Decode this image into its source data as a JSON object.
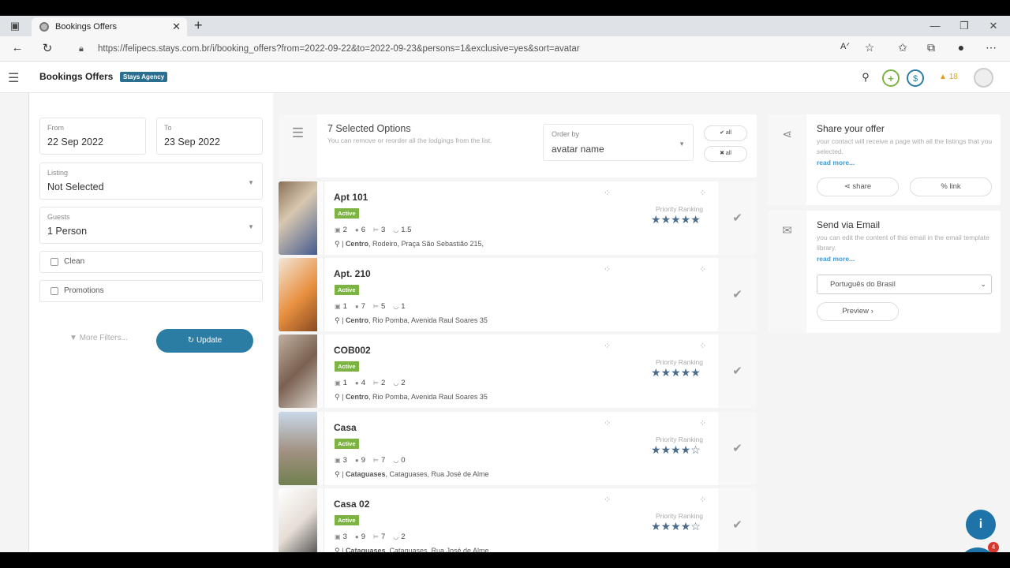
{
  "browser": {
    "tab_title": "Bookings Offers",
    "url": "https://felipecs.stays.com.br/i/booking_offers?from=2022-09-22&to=2022-09-23&persons=1&exclusive=yes&sort=avatar"
  },
  "header": {
    "title": "Bookings Offers",
    "badge": "Stays Agency",
    "alerts_count": "18"
  },
  "filters": {
    "from_label": "From",
    "from_value": "22 Sep 2022",
    "to_label": "To",
    "to_value": "23 Sep 2022",
    "listing_label": "Listing",
    "listing_value": "Not Selected",
    "guests_label": "Guests",
    "guests_value": "1 Person",
    "clean_label": "Clean",
    "promotions_label": "Promotions",
    "more_filters": "More Filters...",
    "update": "Update"
  },
  "selection": {
    "title": "7 Selected Options",
    "subtitle": "You can remove or reorder all the lodgings from the list.",
    "order_label": "Order by",
    "order_value": "avatar name",
    "check_all": "all",
    "uncheck_all": "all"
  },
  "listings": [
    {
      "name": "Apt 101",
      "status": "Active",
      "s1": "2",
      "s2": "6",
      "s3": "3",
      "s4": "1.5",
      "region": "Centro",
      "address": ", Rodeiro, Praça São Sebastião 215,",
      "priority_label": "Priority Ranking",
      "rating": 5
    },
    {
      "name": "Apt. 210",
      "status": "Active",
      "s1": "1",
      "s2": "7",
      "s3": "5",
      "s4": "1",
      "region": "Centro",
      "address": ", Rio Pomba, Avenida Raul Soares 35",
      "priority_label": "",
      "rating": 0
    },
    {
      "name": "COB002",
      "status": "Active",
      "s1": "1",
      "s2": "4",
      "s3": "2",
      "s4": "2",
      "region": "Centro",
      "address": ", Rio Pomba, Avenida Raul Soares 35",
      "priority_label": "Priority Ranking",
      "rating": 5
    },
    {
      "name": "Casa",
      "status": "Active",
      "s1": "3",
      "s2": "9",
      "s3": "7",
      "s4": "0",
      "region": "Cataguases",
      "address": ", Cataguases, Rua José de Alme",
      "priority_label": "Priority Ranking",
      "rating": 4
    },
    {
      "name": "Casa 02",
      "status": "Active",
      "s1": "3",
      "s2": "9",
      "s3": "7",
      "s4": "2",
      "region": "Cataguases",
      "address": ", Cataguases, Rua José de Alme",
      "priority_label": "Priority Ranking",
      "rating": 4
    }
  ],
  "share": {
    "title": "Share your offer",
    "subtitle": "your contact will receive a page with all the listings that you selected.",
    "read_more": "read more...",
    "share_btn": "share",
    "link_btn": "link"
  },
  "email": {
    "title": "Send via Email",
    "subtitle": "you can edit the content of this email in the email template library.",
    "read_more": "read more...",
    "language": "Português do Brasil",
    "preview_btn": "Preview"
  },
  "chat": {
    "badge": "4"
  },
  "colors": {
    "accent": "#2b7da4",
    "active_badge": "#7cb342",
    "star": "#4a6c8a"
  }
}
